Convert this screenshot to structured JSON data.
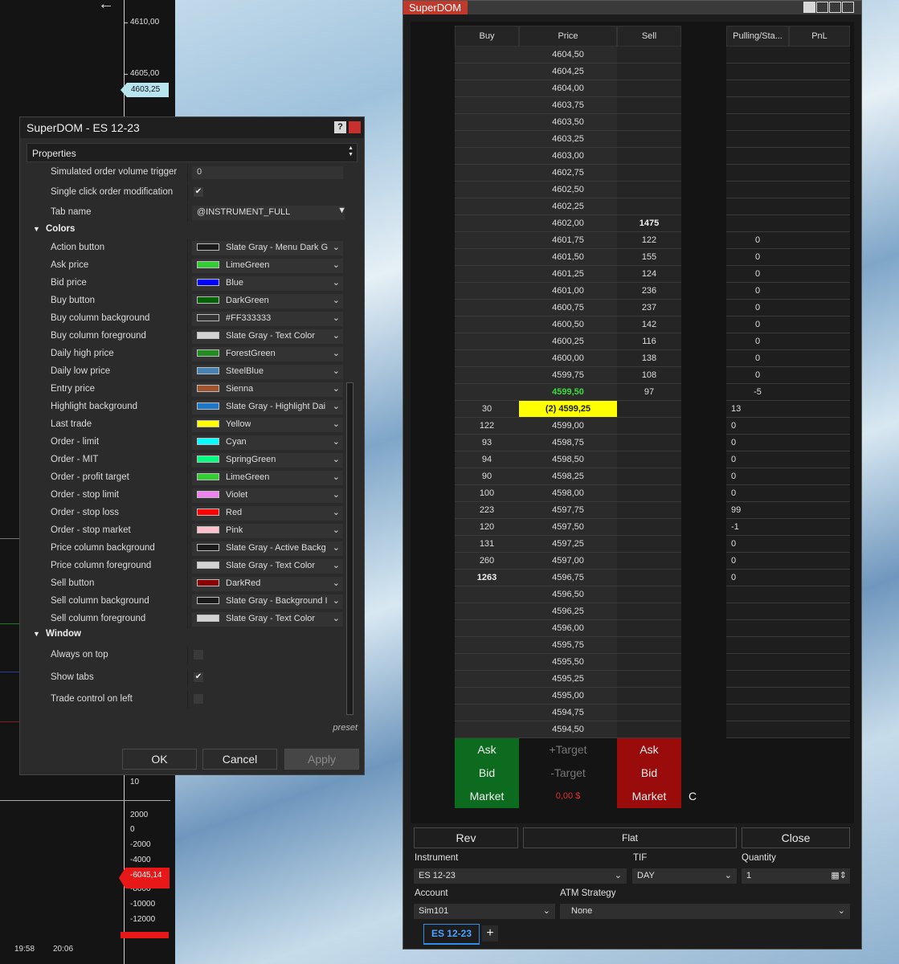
{
  "chart": {
    "axis_labels_top": [
      "4610,00",
      "4605,00"
    ],
    "current_price_marker": "4603,25",
    "axis_labels_bottom": [
      "10",
      "2000",
      "0",
      "-2000",
      "-4000",
      "-8000",
      "-10000",
      "-12000"
    ],
    "pnl_marker": "-6045,14",
    "time_labels": [
      "19:58",
      "20:06"
    ]
  },
  "properties_dialog": {
    "title": "SuperDOM - ES 12-23",
    "help_label": "?",
    "section_header": "Properties",
    "simulated_trigger": {
      "label": "Simulated order volume trigger",
      "value": "0"
    },
    "single_click": {
      "label": "Single click order modification",
      "checked": "✔"
    },
    "tab_name": {
      "label": "Tab name",
      "value": "@INSTRUMENT_FULL"
    },
    "colors_group": "Colors",
    "colors": [
      {
        "label": "Action button",
        "color_name": "Slate Gray - Menu Dark G",
        "swatch": "#1a1a1a"
      },
      {
        "label": "Ask price",
        "color_name": "LimeGreen",
        "swatch": "#32cd32"
      },
      {
        "label": "Bid price",
        "color_name": "Blue",
        "swatch": "#0000ff"
      },
      {
        "label": "Buy button",
        "color_name": "DarkGreen",
        "swatch": "#006400"
      },
      {
        "label": "Buy column background",
        "color_name": "#FF333333",
        "swatch": "#333333"
      },
      {
        "label": "Buy column foreground",
        "color_name": "Slate Gray - Text Color",
        "swatch": "#d3d3d3"
      },
      {
        "label": "Daily high price",
        "color_name": "ForestGreen",
        "swatch": "#228b22"
      },
      {
        "label": "Daily low price",
        "color_name": "SteelBlue",
        "swatch": "#4682b4"
      },
      {
        "label": "Entry price",
        "color_name": "Sienna",
        "swatch": "#a0522d"
      },
      {
        "label": "Highlight background",
        "color_name": "Slate Gray - Highlight Dai",
        "swatch": "#1e78c8"
      },
      {
        "label": "Last trade",
        "color_name": "Yellow",
        "swatch": "#ffff00"
      },
      {
        "label": "Order - limit",
        "color_name": "Cyan",
        "swatch": "#00ffff"
      },
      {
        "label": "Order - MIT",
        "color_name": "SpringGreen",
        "swatch": "#00ff7f"
      },
      {
        "label": "Order - profit target",
        "color_name": "LimeGreen",
        "swatch": "#32cd32"
      },
      {
        "label": "Order - stop limit",
        "color_name": "Violet",
        "swatch": "#ee82ee"
      },
      {
        "label": "Order - stop loss",
        "color_name": "Red",
        "swatch": "#ff0000"
      },
      {
        "label": "Order - stop market",
        "color_name": "Pink",
        "swatch": "#ffc0cb"
      },
      {
        "label": "Price column background",
        "color_name": "Slate Gray - Active Backg",
        "swatch": "#1a1a1a"
      },
      {
        "label": "Price column foreground",
        "color_name": "Slate Gray - Text Color",
        "swatch": "#d3d3d3"
      },
      {
        "label": "Sell button",
        "color_name": "DarkRed",
        "swatch": "#8b0000"
      },
      {
        "label": "Sell column background",
        "color_name": "Slate Gray - Background I",
        "swatch": "#1a1a1a"
      },
      {
        "label": "Sell column foreground",
        "color_name": "Slate Gray - Text Color",
        "swatch": "#d3d3d3"
      }
    ],
    "window_group": "Window",
    "window_options": [
      {
        "label": "Always on top",
        "checked": ""
      },
      {
        "label": "Show tabs",
        "checked": "✔"
      },
      {
        "label": "Trade control on left",
        "checked": ""
      }
    ],
    "preset_label": "preset",
    "ok_label": "OK",
    "cancel_label": "Cancel",
    "apply_label": "Apply"
  },
  "superdom": {
    "title": "SuperDOM",
    "headers": {
      "buy": "Buy",
      "price": "Price",
      "sell": "Sell",
      "pulling": "Pulling/Sta...",
      "pnl": "PnL"
    },
    "rows": [
      {
        "buy": "",
        "price": "4604,50",
        "sell": "",
        "pull": ""
      },
      {
        "buy": "",
        "price": "4604,25",
        "sell": "",
        "pull": ""
      },
      {
        "buy": "",
        "price": "4604,00",
        "sell": "",
        "pull": ""
      },
      {
        "buy": "",
        "price": "4603,75",
        "sell": "",
        "pull": ""
      },
      {
        "buy": "",
        "price": "4603,50",
        "sell": "",
        "pull": ""
      },
      {
        "buy": "",
        "price": "4603,25",
        "sell": "",
        "pull": ""
      },
      {
        "buy": "",
        "price": "4603,00",
        "sell": "",
        "pull": ""
      },
      {
        "buy": "",
        "price": "4602,75",
        "sell": "",
        "pull": ""
      },
      {
        "buy": "",
        "price": "4602,50",
        "sell": "",
        "pull": ""
      },
      {
        "buy": "",
        "price": "4602,25",
        "sell": "",
        "pull": ""
      },
      {
        "buy": "",
        "price": "4602,00",
        "sell": "1475",
        "pull": ""
      },
      {
        "buy": "",
        "price": "4601,75",
        "sell": "122",
        "pull": "0"
      },
      {
        "buy": "",
        "price": "4601,50",
        "sell": "155",
        "pull": "0"
      },
      {
        "buy": "",
        "price": "4601,25",
        "sell": "124",
        "pull": "0"
      },
      {
        "buy": "",
        "price": "4601,00",
        "sell": "236",
        "pull": "0"
      },
      {
        "buy": "",
        "price": "4600,75",
        "sell": "237",
        "pull": "0"
      },
      {
        "buy": "",
        "price": "4600,50",
        "sell": "142",
        "pull": "0"
      },
      {
        "buy": "",
        "price": "4600,25",
        "sell": "116",
        "pull": "0"
      },
      {
        "buy": "",
        "price": "4600,00",
        "sell": "138",
        "pull": "0"
      },
      {
        "buy": "",
        "price": "4599,75",
        "sell": "108",
        "pull": "0"
      },
      {
        "buy": "",
        "price": "4599,50",
        "sell": "97",
        "pull": "-5"
      },
      {
        "buy": "30",
        "price": "(2) 4599,25",
        "sell": "",
        "pull": "13"
      },
      {
        "buy": "122",
        "price": "4599,00",
        "sell": "",
        "pull": "0"
      },
      {
        "buy": "93",
        "price": "4598,75",
        "sell": "",
        "pull": "0"
      },
      {
        "buy": "94",
        "price": "4598,50",
        "sell": "",
        "pull": "0"
      },
      {
        "buy": "90",
        "price": "4598,25",
        "sell": "",
        "pull": "0"
      },
      {
        "buy": "100",
        "price": "4598,00",
        "sell": "",
        "pull": "0"
      },
      {
        "buy": "223",
        "price": "4597,75",
        "sell": "",
        "pull": "99"
      },
      {
        "buy": "120",
        "price": "4597,50",
        "sell": "",
        "pull": "-1"
      },
      {
        "buy": "131",
        "price": "4597,25",
        "sell": "",
        "pull": "0"
      },
      {
        "buy": "260",
        "price": "4597,00",
        "sell": "",
        "pull": "0"
      },
      {
        "buy": "1263",
        "price": "4596,75",
        "sell": "",
        "pull": "0"
      },
      {
        "buy": "",
        "price": "4596,50",
        "sell": "",
        "pull": ""
      },
      {
        "buy": "",
        "price": "4596,25",
        "sell": "",
        "pull": ""
      },
      {
        "buy": "",
        "price": "4596,00",
        "sell": "",
        "pull": ""
      },
      {
        "buy": "",
        "price": "4595,75",
        "sell": "",
        "pull": ""
      },
      {
        "buy": "",
        "price": "4595,50",
        "sell": "",
        "pull": ""
      },
      {
        "buy": "",
        "price": "4595,25",
        "sell": "",
        "pull": ""
      },
      {
        "buy": "",
        "price": "4595,00",
        "sell": "",
        "pull": ""
      },
      {
        "buy": "",
        "price": "4594,75",
        "sell": "",
        "pull": ""
      },
      {
        "buy": "",
        "price": "4594,50",
        "sell": "",
        "pull": ""
      }
    ],
    "buttons": {
      "buy_ask": "Ask",
      "plus_target": "+Target",
      "sell_ask": "Ask",
      "buy_bid": "Bid",
      "minus_target": "-Target",
      "sell_bid": "Bid",
      "buy_market": "Market",
      "pnl_value": "0,00 $",
      "sell_market": "Market",
      "c_label": "C"
    },
    "rev_label": "Rev",
    "flat_label": "Flat",
    "close_label": "Close",
    "instrument_label": "Instrument",
    "instrument_value": "ES 12-23",
    "tif_label": "TIF",
    "tif_value": "DAY",
    "quantity_label": "Quantity",
    "quantity_value": "1",
    "account_label": "Account",
    "account_value": "Sim101",
    "atm_label": "ATM Strategy",
    "atm_value": "None",
    "tab_label": "ES 12-23",
    "tab_add": "+"
  }
}
